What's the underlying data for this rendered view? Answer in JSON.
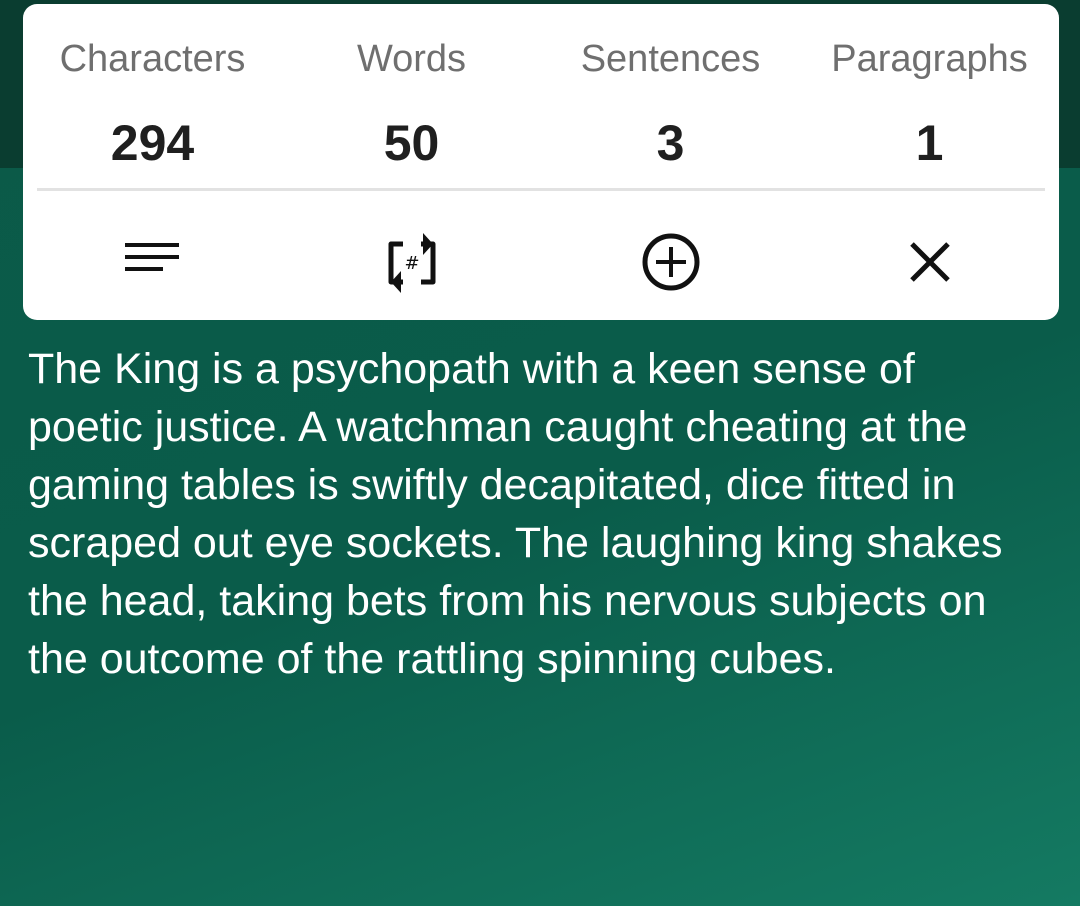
{
  "stats": {
    "labels": {
      "characters": "Characters",
      "words": "Words",
      "sentences": "Sentences",
      "paragraphs": "Paragraphs"
    },
    "values": {
      "characters": "294",
      "words": "50",
      "sentences": "3",
      "paragraphs": "1"
    }
  },
  "actions": [
    {
      "icon": "text-lines-icon"
    },
    {
      "icon": "count-swap-icon"
    },
    {
      "icon": "add-circle-icon"
    },
    {
      "icon": "close-icon"
    }
  ],
  "text": {
    "body": "The King is a psychopath with a keen sense of poetic justice. A watchman caught cheating at the gaming tables is swiftly decapitated, dice fitted in scraped out eye sockets. The laughing king shakes the head, taking bets from his nervous subjects on the outcome of the rattling spinning cubes."
  },
  "colors": {
    "background": "#0a5c4a",
    "top_band": "#0a3d30",
    "card": "#ffffff",
    "label_gray": "#6f6f6f",
    "value_dark": "#1f1f1f",
    "body_text": "#ffffff"
  }
}
